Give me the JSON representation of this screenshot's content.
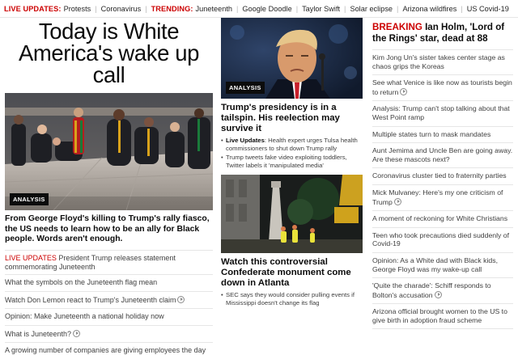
{
  "ticker": {
    "live_label": "LIVE UPDATES:",
    "live_items": [
      "Protests",
      "Coronavirus"
    ],
    "trending_label": "TRENDING:",
    "trending_items": [
      "Juneteenth",
      "Google Doodle",
      "Taylor Swift",
      "Solar eclipse",
      "Arizona wildfires",
      "US Covid-19"
    ]
  },
  "left": {
    "headline": "Today is White America's wake up call",
    "photo_tag": "ANALYSIS",
    "lead": "From George Floyd's killing to Trump's rally fiasco, the US needs to learn how to be an ally for Black people. Words aren't enough.",
    "items": [
      {
        "prefix": "LIVE UPDATES",
        "text": " President Trump releases statement commemorating Juneteenth",
        "video": false
      },
      {
        "prefix": "",
        "text": "What the symbols on the Juneteenth flag mean",
        "video": false
      },
      {
        "prefix": "",
        "text": "Watch Don Lemon react to Trump's Juneteenth claim",
        "video": true
      },
      {
        "prefix": "",
        "text": "Opinion: Make Juneteenth a national holiday now",
        "video": false
      },
      {
        "prefix": "",
        "text": "What is Juneteenth?",
        "video": true
      },
      {
        "prefix": "",
        "text": "A growing number of companies are giving employees the day off to celebrate Juneteenth",
        "video": false
      }
    ]
  },
  "middle": {
    "story1": {
      "photo_tag": "ANALYSIS",
      "headline": "Trump's presidency is in a tailspin. His reelection may survive it",
      "bullets": [
        {
          "prefix": "Live Updates",
          "text": ": Health expert urges Tulsa health commissioners to shut down Trump rally"
        },
        {
          "prefix": "",
          "text": "Trump tweets fake video exploiting toddlers, Twitter labels it 'manipulated media'"
        }
      ]
    },
    "story2": {
      "headline": "Watch this controversial Confederate monument come down in Atlanta",
      "bullets": [
        {
          "prefix": "",
          "text": "SEC says they would consider pulling events if Mississippi doesn't change its flag"
        }
      ]
    }
  },
  "right": {
    "breaking_label": "BREAKING",
    "breaking_text": " Ian Holm, 'Lord of the Rings' star, dead at 88",
    "items": [
      {
        "text": "Kim Jong Un's sister takes center stage as chaos grips the Koreas",
        "video": false
      },
      {
        "text": "See what Venice is like now as tourists begin to return",
        "video": true
      },
      {
        "text": "Analysis: Trump can't stop talking about that West Point ramp",
        "video": false
      },
      {
        "text": "Multiple states turn to mask mandates",
        "video": false
      },
      {
        "text": "Aunt Jemima and Uncle Ben are going away. Are these mascots next?",
        "video": false
      },
      {
        "text": "Coronavirus cluster tied to fraternity parties",
        "video": false
      },
      {
        "text": "Mick Mulvaney: Here's my one criticism of Trump",
        "video": true
      },
      {
        "text": "A moment of reckoning for White Christians",
        "video": false
      },
      {
        "text": "Teen who took precautions died suddenly of Covid-19",
        "video": false
      },
      {
        "text": "Opinion: As a White dad with Black kids, George Floyd was my wake-up call",
        "video": false
      },
      {
        "text": "'Quite the charade': Schiff responds to Bolton's accusation",
        "video": true
      },
      {
        "text": "Arizona official brought women to the US to give birth in adoption fraud scheme",
        "video": false
      }
    ]
  }
}
